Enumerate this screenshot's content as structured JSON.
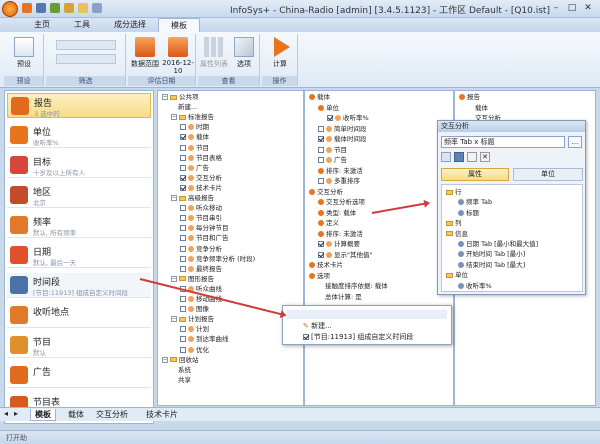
{
  "window": {
    "title": "InfoSys+ - China-Radio [admin] [3.4.5.1123] - 工作区 Default - [Q10.ist]",
    "min": "–",
    "max": "□",
    "close": "✕"
  },
  "ribbon_tabs": [
    "主页",
    "工具",
    "成分选择",
    "模板"
  ],
  "ribbon": {
    "groups": [
      {
        "label": "预设",
        "buttons": [
          "预设"
        ]
      },
      {
        "label": "筛选",
        "buttons": []
      },
      {
        "label": "评估日期",
        "buttons": [
          "数据范围",
          "2016-12-10"
        ]
      },
      {
        "label": "查看",
        "buttons": [
          "属性列表",
          "选项"
        ]
      },
      {
        "label": "操作",
        "buttons": [
          "计算"
        ]
      }
    ]
  },
  "left_items": [
    {
      "title": "报告",
      "sub": "3 选中的",
      "icon": "report-icon",
      "color": "#e06a1e",
      "state": "sel"
    },
    {
      "title": "单位",
      "sub": "收听率%",
      "icon": "unit-icon",
      "color": "#e8741e",
      "state": ""
    },
    {
      "title": "目标",
      "sub": "十岁及以上所有人",
      "icon": "target-icon",
      "color": "#d6463a",
      "state": ""
    },
    {
      "title": "地区",
      "sub": "北京",
      "icon": "region-icon",
      "color": "#c44b2a",
      "state": ""
    },
    {
      "title": "频率",
      "sub": "默认, 所有频率",
      "icon": "frequency-icon",
      "color": "#e07a2a",
      "state": ""
    },
    {
      "title": "日期",
      "sub": "默认, 最后一天",
      "icon": "calendar-icon",
      "color": "#e0502a",
      "state": ""
    },
    {
      "title": "时间段",
      "sub": "[节目:11913] 组成自定义时间段",
      "icon": "clock-icon",
      "color": "#4a72a8",
      "state": "hl"
    },
    {
      "title": "收听地点",
      "sub": "",
      "icon": "location-icon",
      "color": "#e07a2a",
      "state": ""
    },
    {
      "title": "节目",
      "sub": "默认",
      "icon": "program-icon",
      "color": "#e0902a",
      "state": ""
    },
    {
      "title": "广告",
      "sub": "",
      "icon": "ad-icon",
      "color": "#e06a1e",
      "state": ""
    },
    {
      "title": "节目表",
      "sub": "",
      "icon": "schedule-icon",
      "color": "#d65a1e",
      "state": ""
    }
  ],
  "tree1": [
    {
      "d": 0,
      "t": "公共项",
      "k": "folder"
    },
    {
      "d": 1,
      "t": "新建...",
      "k": "plain"
    },
    {
      "d": 1,
      "t": "标准报告",
      "k": "folder"
    },
    {
      "d": 2,
      "t": "时期",
      "k": "cb"
    },
    {
      "d": 2,
      "t": "载体",
      "k": "cbon"
    },
    {
      "d": 2,
      "t": "节目",
      "k": "cb"
    },
    {
      "d": 2,
      "t": "节目表格",
      "k": "cb"
    },
    {
      "d": 2,
      "t": "广告",
      "k": "cb"
    },
    {
      "d": 2,
      "t": "交互分析",
      "k": "cbon"
    },
    {
      "d": 2,
      "t": "技术卡片",
      "k": "cbon"
    },
    {
      "d": 1,
      "t": "高级报告",
      "k": "folder"
    },
    {
      "d": 2,
      "t": "听众移动",
      "k": "cb"
    },
    {
      "d": 2,
      "t": "节目串引",
      "k": "cb"
    },
    {
      "d": 2,
      "t": "每分钟节目",
      "k": "cb"
    },
    {
      "d": 2,
      "t": "节目和广告",
      "k": "cb"
    },
    {
      "d": 2,
      "t": "竞争分析",
      "k": "cb"
    },
    {
      "d": 2,
      "t": "竞争频率分析 (时段)",
      "k": "cb"
    },
    {
      "d": 2,
      "t": "最终报告",
      "k": "cb"
    },
    {
      "d": 1,
      "t": "图形报告",
      "k": "folder"
    },
    {
      "d": 2,
      "t": "听众曲线",
      "k": "cb"
    },
    {
      "d": 2,
      "t": "移动曲线",
      "k": "cb"
    },
    {
      "d": 2,
      "t": "图像",
      "k": "cb"
    },
    {
      "d": 1,
      "t": "计划报告",
      "k": "folder"
    },
    {
      "d": 2,
      "t": "计划",
      "k": "cb"
    },
    {
      "d": 2,
      "t": "到达率曲线",
      "k": "cb"
    },
    {
      "d": 2,
      "t": "优化",
      "k": "cb"
    },
    {
      "d": 0,
      "t": "回收站",
      "k": "folder"
    },
    {
      "d": 1,
      "t": "系统",
      "k": "plain"
    },
    {
      "d": 1,
      "t": "共享",
      "k": "plain"
    }
  ],
  "tree2": [
    {
      "d": 0,
      "t": "载体",
      "k": "dot"
    },
    {
      "d": 1,
      "t": "单位",
      "k": "dot"
    },
    {
      "d": 2,
      "t": "收听率%",
      "k": "cbon"
    },
    {
      "d": 1,
      "t": "简单时间段",
      "k": "cb"
    },
    {
      "d": 1,
      "t": "载体时间段",
      "k": "cbon"
    },
    {
      "d": 1,
      "t": "节目",
      "k": "cb"
    },
    {
      "d": 1,
      "t": "广告",
      "k": "cb"
    },
    {
      "d": 1,
      "t": "排序: 未激活",
      "k": "dot"
    },
    {
      "d": 1,
      "t": "多重排序",
      "k": "cb"
    },
    {
      "d": 0,
      "t": "交互分析",
      "k": "dot"
    },
    {
      "d": 1,
      "t": "交互分析选项",
      "k": "dot"
    },
    {
      "d": 1,
      "t": "类型: 载体",
      "k": "dot"
    },
    {
      "d": 1,
      "t": "定义",
      "k": "dot"
    },
    {
      "d": 1,
      "t": "排序: 未激活",
      "k": "dot"
    },
    {
      "d": 1,
      "t": "计算概要",
      "k": "cbon"
    },
    {
      "d": 1,
      "t": "显示\"其他值\"",
      "k": "cbon"
    },
    {
      "d": 0,
      "t": "技术卡片",
      "k": "dot"
    },
    {
      "d": 0,
      "t": "选项",
      "k": "dot"
    },
    {
      "d": 1,
      "t": "接触度排序依据: 载体",
      "k": "plain"
    },
    {
      "d": 1,
      "t": "总体计算: 是",
      "k": "plain"
    }
  ],
  "tree3": [
    {
      "d": 0,
      "t": "报告",
      "k": "dot"
    },
    {
      "d": 1,
      "t": "载体",
      "k": "plain"
    },
    {
      "d": 1,
      "t": "交互分析",
      "k": "plain"
    }
  ],
  "dialog": {
    "title": "交互分析",
    "combo": "频率 Tab x 标题",
    "tab_attr": "属性",
    "tab_unit": "单位",
    "rows": [
      {
        "d": 0,
        "t": "行",
        "k": "fold"
      },
      {
        "d": 1,
        "t": "频率 Tab",
        "k": "item"
      },
      {
        "d": 1,
        "t": "标题",
        "k": "item"
      },
      {
        "d": 0,
        "t": "列",
        "k": "fold"
      },
      {
        "d": 0,
        "t": "信息",
        "k": "fold"
      },
      {
        "d": 1,
        "t": "日期 Tab [最小和最大值]",
        "k": "item"
      },
      {
        "d": 1,
        "t": "开始时间 Tab [最小]",
        "k": "item"
      },
      {
        "d": 1,
        "t": "结束时间 Tab [最大]",
        "k": "item"
      },
      {
        "d": 0,
        "t": "单位",
        "k": "fold"
      },
      {
        "d": 1,
        "t": "收听率%",
        "k": "item"
      }
    ]
  },
  "popup": {
    "new": "新建...",
    "item": "[节目:11913] 组成自定义时间段"
  },
  "bottom_tabs": [
    "模板",
    "载体",
    "交互分析",
    "技术卡片"
  ],
  "status": "打开助"
}
